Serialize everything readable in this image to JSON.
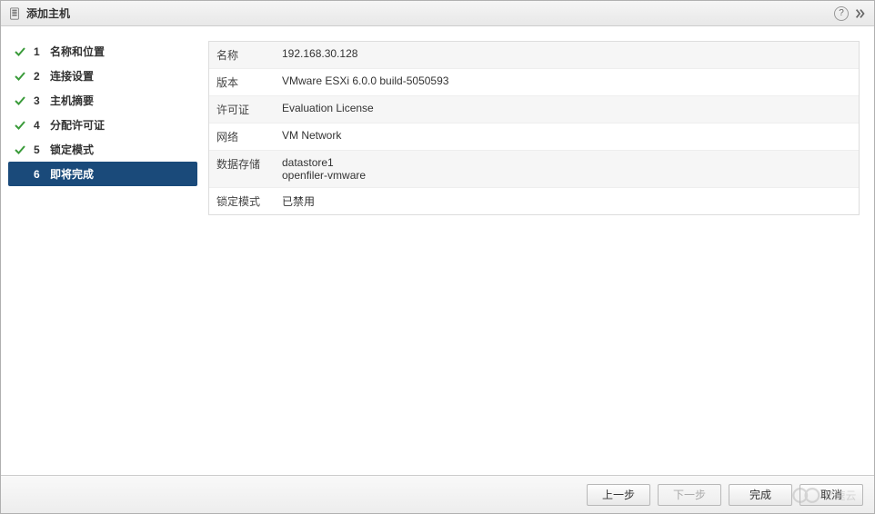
{
  "titlebar": {
    "title": "添加主机"
  },
  "sidebar": {
    "steps": [
      {
        "num": "1",
        "label": "名称和位置",
        "done": true,
        "active": false
      },
      {
        "num": "2",
        "label": "连接设置",
        "done": true,
        "active": false
      },
      {
        "num": "3",
        "label": "主机摘要",
        "done": true,
        "active": false
      },
      {
        "num": "4",
        "label": "分配许可证",
        "done": true,
        "active": false
      },
      {
        "num": "5",
        "label": "锁定模式",
        "done": true,
        "active": false
      },
      {
        "num": "6",
        "label": "即将完成",
        "done": false,
        "active": true
      }
    ]
  },
  "summary": {
    "rows": [
      {
        "label": "名称",
        "value": "192.168.30.128"
      },
      {
        "label": "版本",
        "value": "VMware ESXi 6.0.0 build-5050593"
      },
      {
        "label": "许可证",
        "value": "Evaluation License"
      },
      {
        "label": "网络",
        "value": "VM Network"
      },
      {
        "label": "数据存储",
        "value": "datastore1\nopenfiler-vmware"
      },
      {
        "label": "锁定模式",
        "value": "已禁用"
      }
    ]
  },
  "footer": {
    "back": "上一步",
    "next": "下一步",
    "finish": "完成",
    "cancel": "取消"
  },
  "watermark": {
    "text": "亿速云"
  }
}
